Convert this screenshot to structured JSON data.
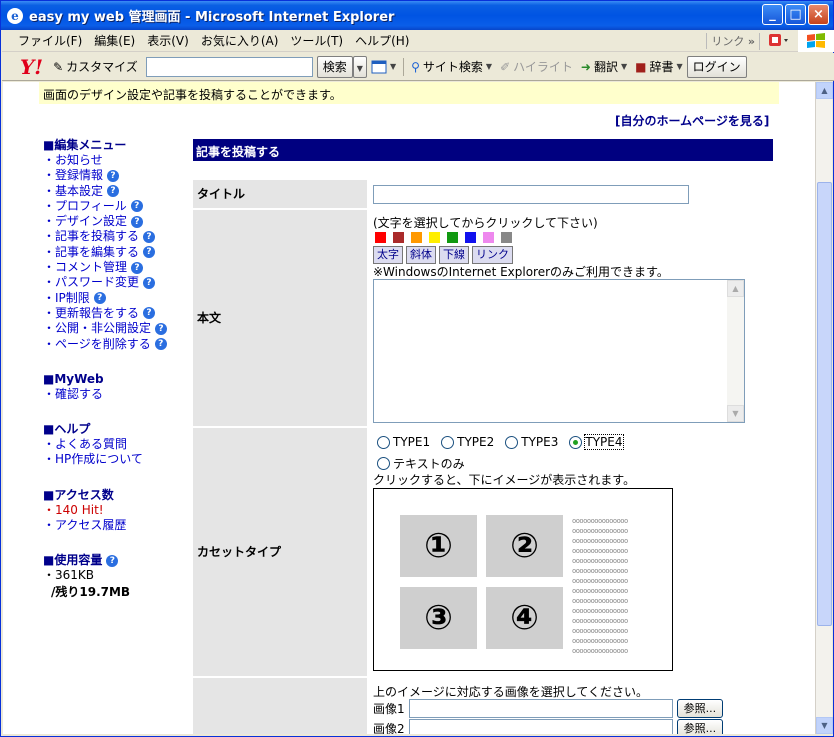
{
  "window": {
    "title": "easy my web 管理画面 - Microsoft Internet Explorer",
    "minimize": "_",
    "maximize": "□",
    "close": "×"
  },
  "menu": {
    "items": [
      "ファイル(F)",
      "編集(E)",
      "表示(V)",
      "お気に入り(A)",
      "ツール(T)",
      "ヘルプ(H)"
    ],
    "links_label": "リンク",
    "chevron": "»"
  },
  "toolbar": {
    "yahoo": "Y!",
    "customize": "カスタマイズ",
    "search_value": "",
    "search_btn": "検索",
    "site_search": "サイト検索",
    "highlight": "ハイライト",
    "translate": "翻訳",
    "dictionary": "辞書",
    "login": "ログイン"
  },
  "page": {
    "notice": "画面のデザイン設定や記事を投稿することができます。",
    "home_link": "[自分のホームページを見る]"
  },
  "sidebar": {
    "edit_menu": {
      "title": "■編集メニュー",
      "items": [
        {
          "label": "・お知らせ",
          "help": false
        },
        {
          "label": "・登録情報",
          "help": true
        },
        {
          "label": "・基本設定",
          "help": true
        },
        {
          "label": "・プロフィール",
          "help": true
        },
        {
          "label": "・デザイン設定",
          "help": true
        },
        {
          "label": "・記事を投稿する",
          "help": true
        },
        {
          "label": "・記事を編集する",
          "help": true
        },
        {
          "label": "・コメント管理",
          "help": true
        },
        {
          "label": "・パスワード変更",
          "help": true
        },
        {
          "label": "・IP制限",
          "help": true
        },
        {
          "label": "・更新報告をする",
          "help": true
        },
        {
          "label": "・公開・非公開設定",
          "help": true
        },
        {
          "label": "・ページを削除する",
          "help": true
        }
      ]
    },
    "myweb": {
      "title": "■MyWeb",
      "items": [
        "・確認する"
      ]
    },
    "help": {
      "title": "■ヘルプ",
      "items": [
        "・よくある質問",
        "・HP作成について"
      ]
    },
    "access": {
      "title": "■アクセス数",
      "hits": "・140 Hit!",
      "history": "・アクセス履歴"
    },
    "usage": {
      "title": "■使用容量",
      "used": "・361KB",
      "remaining": "/残り19.7MB"
    },
    "help_icon": "?"
  },
  "form": {
    "header": "記事を投稿する",
    "title_label": "タイトル",
    "title_value": "",
    "body_label": "本文",
    "body_hint": "(文字を選択してからクリックして下さい)",
    "colors": [
      "#ff0000",
      "#aa2a2a",
      "#ff9900",
      "#ffee00",
      "#119911",
      "#1111ee",
      "#ee88ee",
      "#888888"
    ],
    "format_buttons": [
      "太字",
      "斜体",
      "下線",
      "リンク"
    ],
    "ie_note": "※WindowsのInternet Explorerのみご利用できます。",
    "body_value": "",
    "cassette_label": "カセットタイプ",
    "types": [
      {
        "label": "TYPE1",
        "checked": false
      },
      {
        "label": "TYPE2",
        "checked": false
      },
      {
        "label": "TYPE3",
        "checked": false
      },
      {
        "label": "TYPE4",
        "checked": true
      }
    ],
    "text_only": "テキストのみ",
    "click_note": "クリックすると、下にイメージが表示されます。",
    "preview_numbers": [
      "①",
      "②",
      "③",
      "④"
    ],
    "image_prompt": "上のイメージに対応する画像を選択してください。",
    "image1_label": "画像1",
    "image2_label": "画像2",
    "browse": "参照..."
  },
  "scroll": {
    "up": "▲",
    "down": "▼"
  }
}
